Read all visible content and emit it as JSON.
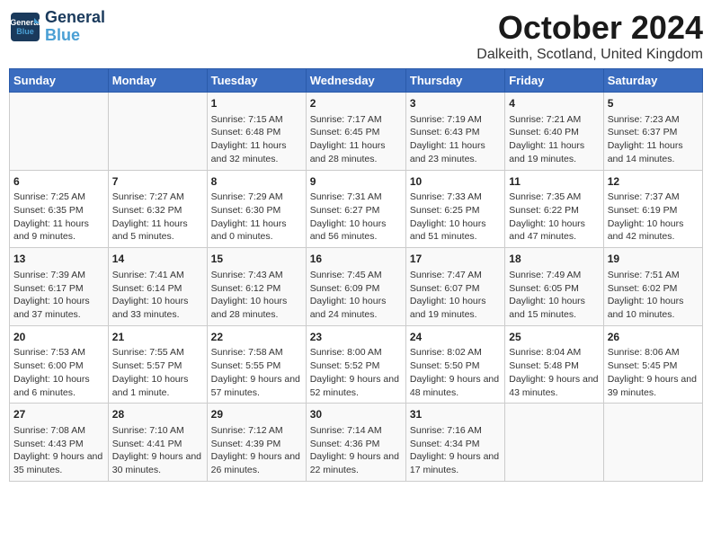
{
  "header": {
    "logo_line1": "General",
    "logo_line2": "Blue",
    "title": "October 2024",
    "subtitle": "Dalkeith, Scotland, United Kingdom"
  },
  "weekdays": [
    "Sunday",
    "Monday",
    "Tuesday",
    "Wednesday",
    "Thursday",
    "Friday",
    "Saturday"
  ],
  "weeks": [
    [
      {
        "day": "",
        "sunrise": "",
        "sunset": "",
        "daylight": ""
      },
      {
        "day": "",
        "sunrise": "",
        "sunset": "",
        "daylight": ""
      },
      {
        "day": "1",
        "sunrise": "Sunrise: 7:15 AM",
        "sunset": "Sunset: 6:48 PM",
        "daylight": "Daylight: 11 hours and 32 minutes."
      },
      {
        "day": "2",
        "sunrise": "Sunrise: 7:17 AM",
        "sunset": "Sunset: 6:45 PM",
        "daylight": "Daylight: 11 hours and 28 minutes."
      },
      {
        "day": "3",
        "sunrise": "Sunrise: 7:19 AM",
        "sunset": "Sunset: 6:43 PM",
        "daylight": "Daylight: 11 hours and 23 minutes."
      },
      {
        "day": "4",
        "sunrise": "Sunrise: 7:21 AM",
        "sunset": "Sunset: 6:40 PM",
        "daylight": "Daylight: 11 hours and 19 minutes."
      },
      {
        "day": "5",
        "sunrise": "Sunrise: 7:23 AM",
        "sunset": "Sunset: 6:37 PM",
        "daylight": "Daylight: 11 hours and 14 minutes."
      }
    ],
    [
      {
        "day": "6",
        "sunrise": "Sunrise: 7:25 AM",
        "sunset": "Sunset: 6:35 PM",
        "daylight": "Daylight: 11 hours and 9 minutes."
      },
      {
        "day": "7",
        "sunrise": "Sunrise: 7:27 AM",
        "sunset": "Sunset: 6:32 PM",
        "daylight": "Daylight: 11 hours and 5 minutes."
      },
      {
        "day": "8",
        "sunrise": "Sunrise: 7:29 AM",
        "sunset": "Sunset: 6:30 PM",
        "daylight": "Daylight: 11 hours and 0 minutes."
      },
      {
        "day": "9",
        "sunrise": "Sunrise: 7:31 AM",
        "sunset": "Sunset: 6:27 PM",
        "daylight": "Daylight: 10 hours and 56 minutes."
      },
      {
        "day": "10",
        "sunrise": "Sunrise: 7:33 AM",
        "sunset": "Sunset: 6:25 PM",
        "daylight": "Daylight: 10 hours and 51 minutes."
      },
      {
        "day": "11",
        "sunrise": "Sunrise: 7:35 AM",
        "sunset": "Sunset: 6:22 PM",
        "daylight": "Daylight: 10 hours and 47 minutes."
      },
      {
        "day": "12",
        "sunrise": "Sunrise: 7:37 AM",
        "sunset": "Sunset: 6:19 PM",
        "daylight": "Daylight: 10 hours and 42 minutes."
      }
    ],
    [
      {
        "day": "13",
        "sunrise": "Sunrise: 7:39 AM",
        "sunset": "Sunset: 6:17 PM",
        "daylight": "Daylight: 10 hours and 37 minutes."
      },
      {
        "day": "14",
        "sunrise": "Sunrise: 7:41 AM",
        "sunset": "Sunset: 6:14 PM",
        "daylight": "Daylight: 10 hours and 33 minutes."
      },
      {
        "day": "15",
        "sunrise": "Sunrise: 7:43 AM",
        "sunset": "Sunset: 6:12 PM",
        "daylight": "Daylight: 10 hours and 28 minutes."
      },
      {
        "day": "16",
        "sunrise": "Sunrise: 7:45 AM",
        "sunset": "Sunset: 6:09 PM",
        "daylight": "Daylight: 10 hours and 24 minutes."
      },
      {
        "day": "17",
        "sunrise": "Sunrise: 7:47 AM",
        "sunset": "Sunset: 6:07 PM",
        "daylight": "Daylight: 10 hours and 19 minutes."
      },
      {
        "day": "18",
        "sunrise": "Sunrise: 7:49 AM",
        "sunset": "Sunset: 6:05 PM",
        "daylight": "Daylight: 10 hours and 15 minutes."
      },
      {
        "day": "19",
        "sunrise": "Sunrise: 7:51 AM",
        "sunset": "Sunset: 6:02 PM",
        "daylight": "Daylight: 10 hours and 10 minutes."
      }
    ],
    [
      {
        "day": "20",
        "sunrise": "Sunrise: 7:53 AM",
        "sunset": "Sunset: 6:00 PM",
        "daylight": "Daylight: 10 hours and 6 minutes."
      },
      {
        "day": "21",
        "sunrise": "Sunrise: 7:55 AM",
        "sunset": "Sunset: 5:57 PM",
        "daylight": "Daylight: 10 hours and 1 minute."
      },
      {
        "day": "22",
        "sunrise": "Sunrise: 7:58 AM",
        "sunset": "Sunset: 5:55 PM",
        "daylight": "Daylight: 9 hours and 57 minutes."
      },
      {
        "day": "23",
        "sunrise": "Sunrise: 8:00 AM",
        "sunset": "Sunset: 5:52 PM",
        "daylight": "Daylight: 9 hours and 52 minutes."
      },
      {
        "day": "24",
        "sunrise": "Sunrise: 8:02 AM",
        "sunset": "Sunset: 5:50 PM",
        "daylight": "Daylight: 9 hours and 48 minutes."
      },
      {
        "day": "25",
        "sunrise": "Sunrise: 8:04 AM",
        "sunset": "Sunset: 5:48 PM",
        "daylight": "Daylight: 9 hours and 43 minutes."
      },
      {
        "day": "26",
        "sunrise": "Sunrise: 8:06 AM",
        "sunset": "Sunset: 5:45 PM",
        "daylight": "Daylight: 9 hours and 39 minutes."
      }
    ],
    [
      {
        "day": "27",
        "sunrise": "Sunrise: 7:08 AM",
        "sunset": "Sunset: 4:43 PM",
        "daylight": "Daylight: 9 hours and 35 minutes."
      },
      {
        "day": "28",
        "sunrise": "Sunrise: 7:10 AM",
        "sunset": "Sunset: 4:41 PM",
        "daylight": "Daylight: 9 hours and 30 minutes."
      },
      {
        "day": "29",
        "sunrise": "Sunrise: 7:12 AM",
        "sunset": "Sunset: 4:39 PM",
        "daylight": "Daylight: 9 hours and 26 minutes."
      },
      {
        "day": "30",
        "sunrise": "Sunrise: 7:14 AM",
        "sunset": "Sunset: 4:36 PM",
        "daylight": "Daylight: 9 hours and 22 minutes."
      },
      {
        "day": "31",
        "sunrise": "Sunrise: 7:16 AM",
        "sunset": "Sunset: 4:34 PM",
        "daylight": "Daylight: 9 hours and 17 minutes."
      },
      {
        "day": "",
        "sunrise": "",
        "sunset": "",
        "daylight": ""
      },
      {
        "day": "",
        "sunrise": "",
        "sunset": "",
        "daylight": ""
      }
    ]
  ]
}
